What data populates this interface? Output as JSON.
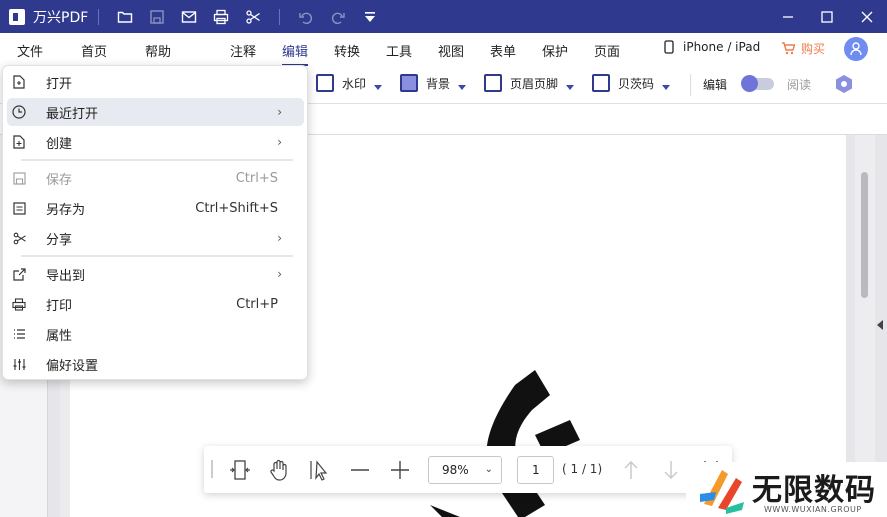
{
  "titlebar": {
    "app_name": "万兴PDF"
  },
  "menubar": {
    "file": "文件",
    "home": "首页",
    "help": "帮助",
    "tabs": [
      "注释",
      "编辑",
      "转换",
      "工具",
      "视图",
      "表单",
      "保护",
      "页面"
    ],
    "active_tab": "编辑",
    "device_label": "iPhone / iPad",
    "buy_label": "购买"
  },
  "toolbar": {
    "watermark": "水印",
    "background": "背景",
    "header_footer": "页眉页脚",
    "bates": "贝茨码",
    "edit_label": "编辑",
    "read_label": "阅读"
  },
  "file_menu": {
    "items": [
      {
        "label": "打开",
        "shortcut": "",
        "submenu": false,
        "icon": "open-file-icon"
      },
      {
        "label": "最近打开",
        "shortcut": "",
        "submenu": true,
        "icon": "clock-icon"
      },
      {
        "label": "创建",
        "shortcut": "",
        "submenu": true,
        "icon": "create-file-icon"
      },
      {
        "label": "保存",
        "shortcut": "Ctrl+S",
        "submenu": false,
        "icon": "save-icon",
        "disabled": true
      },
      {
        "label": "另存为",
        "shortcut": "Ctrl+Shift+S",
        "submenu": false,
        "icon": "save-as-icon"
      },
      {
        "label": "分享",
        "shortcut": "",
        "submenu": true,
        "icon": "share-icon"
      },
      {
        "label": "导出到",
        "shortcut": "",
        "submenu": true,
        "icon": "export-icon"
      },
      {
        "label": "打印",
        "shortcut": "Ctrl+P",
        "submenu": false,
        "icon": "print-icon"
      },
      {
        "label": "属性",
        "shortcut": "",
        "submenu": false,
        "icon": "list-icon"
      },
      {
        "label": "偏好设置",
        "shortcut": "",
        "submenu": false,
        "icon": "sliders-icon"
      }
    ],
    "submenu_arrow": "›"
  },
  "bottombar": {
    "zoom": "98%",
    "page_input": "1",
    "page_total": "( 1 / 1)"
  },
  "watermark_logo": {
    "title": "无限数码",
    "subtitle": "WWW.WUXIAN.GROUP"
  },
  "colors": {
    "brand": "#2f3a8f",
    "accent": "#6f74d8",
    "buy": "#f07a4b"
  }
}
